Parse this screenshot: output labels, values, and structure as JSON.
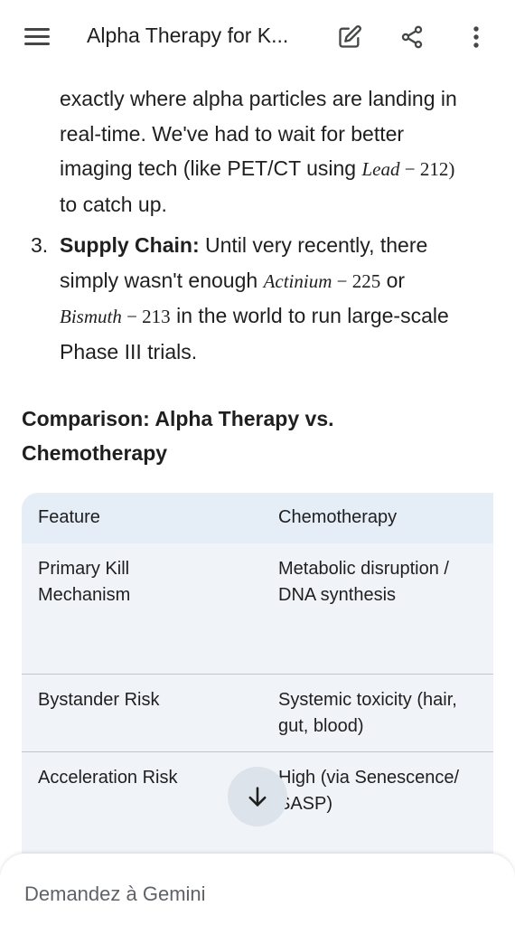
{
  "appbar": {
    "title": "Alpha Therapy for K...",
    "icons": [
      "menu-icon",
      "edit-icon",
      "share-icon",
      "more-vert-icon"
    ]
  },
  "content": {
    "p1_line1": "exactly where alpha particles are landing in",
    "p1_line2": "real-time. We've had to wait for better",
    "p1_line3_text": "imaging tech (like PET/CT using ",
    "p1_math_var": "Lead",
    "p1_math_rest": " − 212)",
    "p1_line4": "to catch up.",
    "item3_num": "3.",
    "item3_bold": "Supply Chain:",
    "item3_line1_rest": " Until very recently, there",
    "item3_line2_text": "simply wasn't enough ",
    "item3_math1_var": "Actinium",
    "item3_math1_rest": " − 225",
    "item3_line2_end": " or",
    "item3_math2_var": "Bismuth",
    "item3_math2_rest": " − 213",
    "item3_line3_end": " in the world to run large-scale",
    "item3_line4": "Phase III trials."
  },
  "heading": {
    "line1": "Comparison: Alpha Therapy vs.",
    "line2": "Chemotherapy"
  },
  "table": {
    "headers": [
      "Feature",
      "Chemotherapy"
    ],
    "rows": [
      {
        "feature": [
          "Primary Kill",
          "Mechanism"
        ],
        "chemo": [
          "Metabolic disruption /",
          "DNA synthesis"
        ]
      },
      {
        "feature": [
          "Bystander Risk"
        ],
        "chemo": [
          "Systemic toxicity (hair,",
          "gut, blood)"
        ]
      },
      {
        "feature": [
          "Acceleration Risk"
        ],
        "chemo": [
          "High (via Senescence/",
          "SASP)"
        ]
      }
    ]
  },
  "composer": {
    "placeholder": "Demandez à Gemini"
  },
  "colors": {
    "table_header_bg": "#e5edf7",
    "table_body_bg": "#f0f4f9",
    "fab_bg": "#dde3ea"
  }
}
